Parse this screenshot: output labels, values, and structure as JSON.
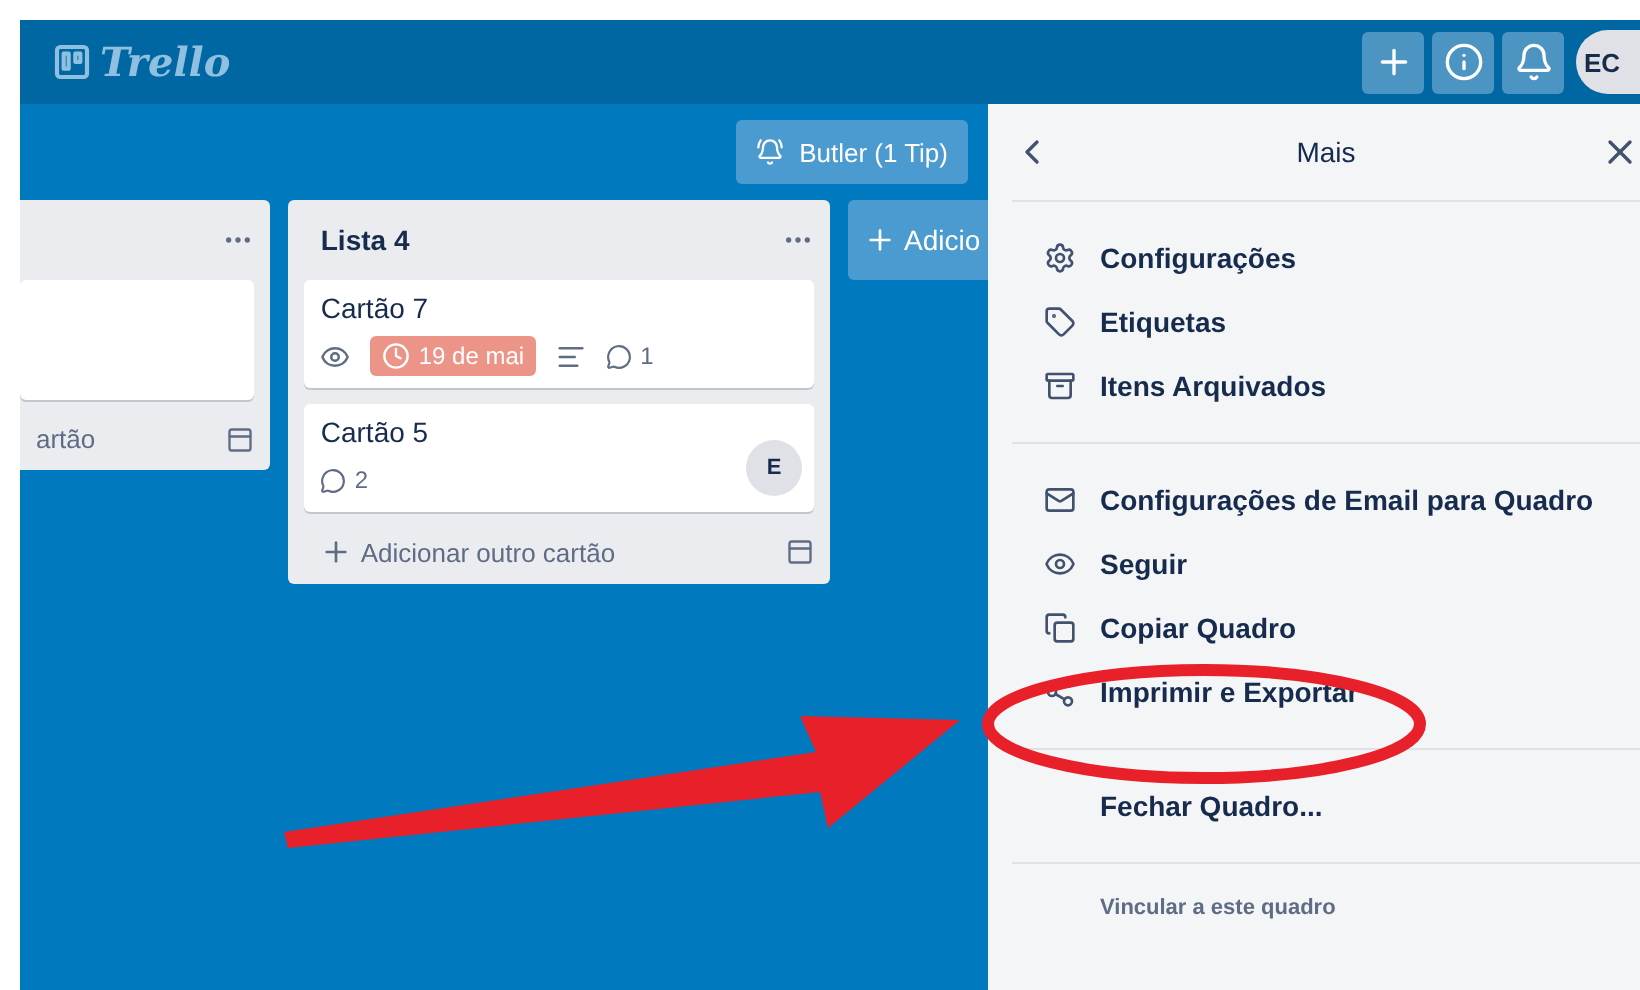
{
  "header": {
    "logo": "Trello",
    "buttons": [
      {
        "kind": "add"
      },
      {
        "kind": "info"
      },
      {
        "kind": "bell"
      }
    ],
    "avatar": "EC"
  },
  "board": {
    "butler": "Butler (1 Tip)",
    "add_list": "Adicio",
    "lists": [
      {
        "kind": "partial",
        "cards": [
          {
            "kind": "blank"
          }
        ],
        "add_card": "artão"
      },
      {
        "kind": "full",
        "title": "Lista 4",
        "cards": [
          {
            "kind": "card",
            "title": "Cartão 7",
            "badges": [
              {
                "kind": "watch"
              },
              {
                "kind": "due",
                "text": "19 de mai"
              },
              {
                "kind": "description"
              },
              {
                "kind": "comments",
                "text": "1"
              }
            ]
          },
          {
            "kind": "card",
            "title": "Cartão 5",
            "badges": [
              {
                "kind": "comments",
                "text": "2"
              }
            ],
            "member": "E"
          }
        ],
        "add_card": "Adicionar outro cartão"
      }
    ]
  },
  "menu": {
    "title": "Mais",
    "groups": [
      [
        {
          "label": "Configurações"
        },
        {
          "label": "Etiquetas"
        },
        {
          "label": "Itens Arquivados"
        }
      ],
      [
        {
          "label": "Configurações de Email para Quadro"
        },
        {
          "label": "Seguir"
        },
        {
          "label": "Copiar Quadro"
        },
        {
          "label": "Imprimir e Exportar"
        }
      ],
      [
        {
          "label": "Fechar Quadro..."
        }
      ]
    ],
    "link_label": "Vincular a este quadro"
  }
}
